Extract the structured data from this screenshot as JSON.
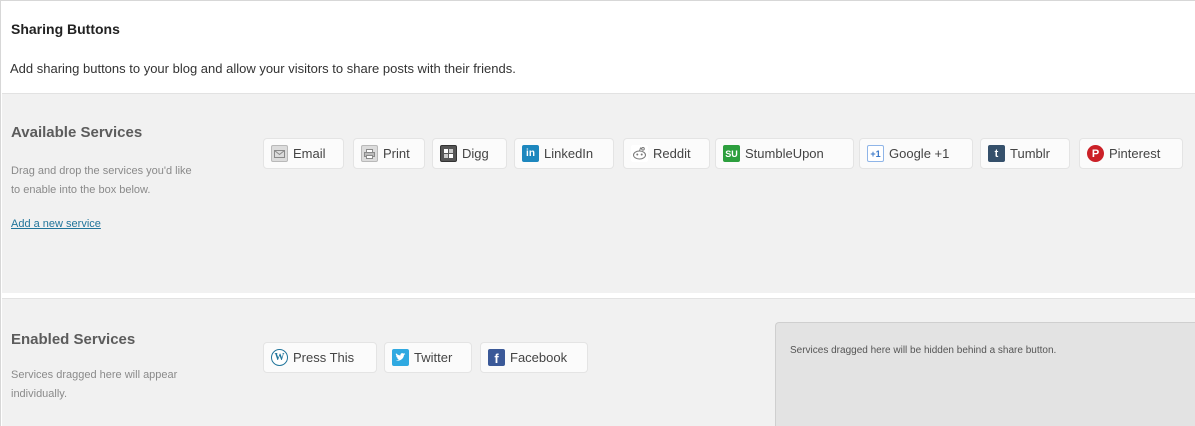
{
  "header": {
    "title": "Sharing Buttons",
    "description": "Add sharing buttons to your blog and allow your visitors to share posts with their friends."
  },
  "available": {
    "title": "Available Services",
    "desc_line1": "Drag and drop the services you'd like",
    "desc_line2": "to enable into the box below.",
    "add_link": "Add a new service",
    "services": [
      {
        "label": "Email",
        "icon": "email-icon"
      },
      {
        "label": "Print",
        "icon": "print-icon"
      },
      {
        "label": "Digg",
        "icon": "digg-icon"
      },
      {
        "label": "LinkedIn",
        "icon": "linkedin-icon"
      },
      {
        "label": "Reddit",
        "icon": "reddit-icon"
      },
      {
        "label": "StumbleUpon",
        "icon": "stumbleupon-icon"
      },
      {
        "label": "Google +1",
        "icon": "google-plus-icon"
      },
      {
        "label": "Tumblr",
        "icon": "tumblr-icon"
      },
      {
        "label": "Pinterest",
        "icon": "pinterest-icon"
      }
    ]
  },
  "enabled": {
    "title": "Enabled Services",
    "desc_line1": "Services dragged here will appear",
    "desc_line2": "individually.",
    "services": [
      {
        "label": "Press This",
        "icon": "wordpress-icon"
      },
      {
        "label": "Twitter",
        "icon": "twitter-icon"
      },
      {
        "label": "Facebook",
        "icon": "facebook-icon"
      }
    ],
    "hidden_box_text": "Services dragged here will be hidden behind a share button."
  },
  "colors": {
    "link": "#21759b",
    "linkedin": "#1d87be",
    "stumbleupon": "#2d9f3e",
    "tumblr": "#35506b",
    "pinterest": "#cb2027",
    "twitter": "#2fa9e1",
    "facebook": "#3b5998",
    "wordpress": "#21759b"
  }
}
